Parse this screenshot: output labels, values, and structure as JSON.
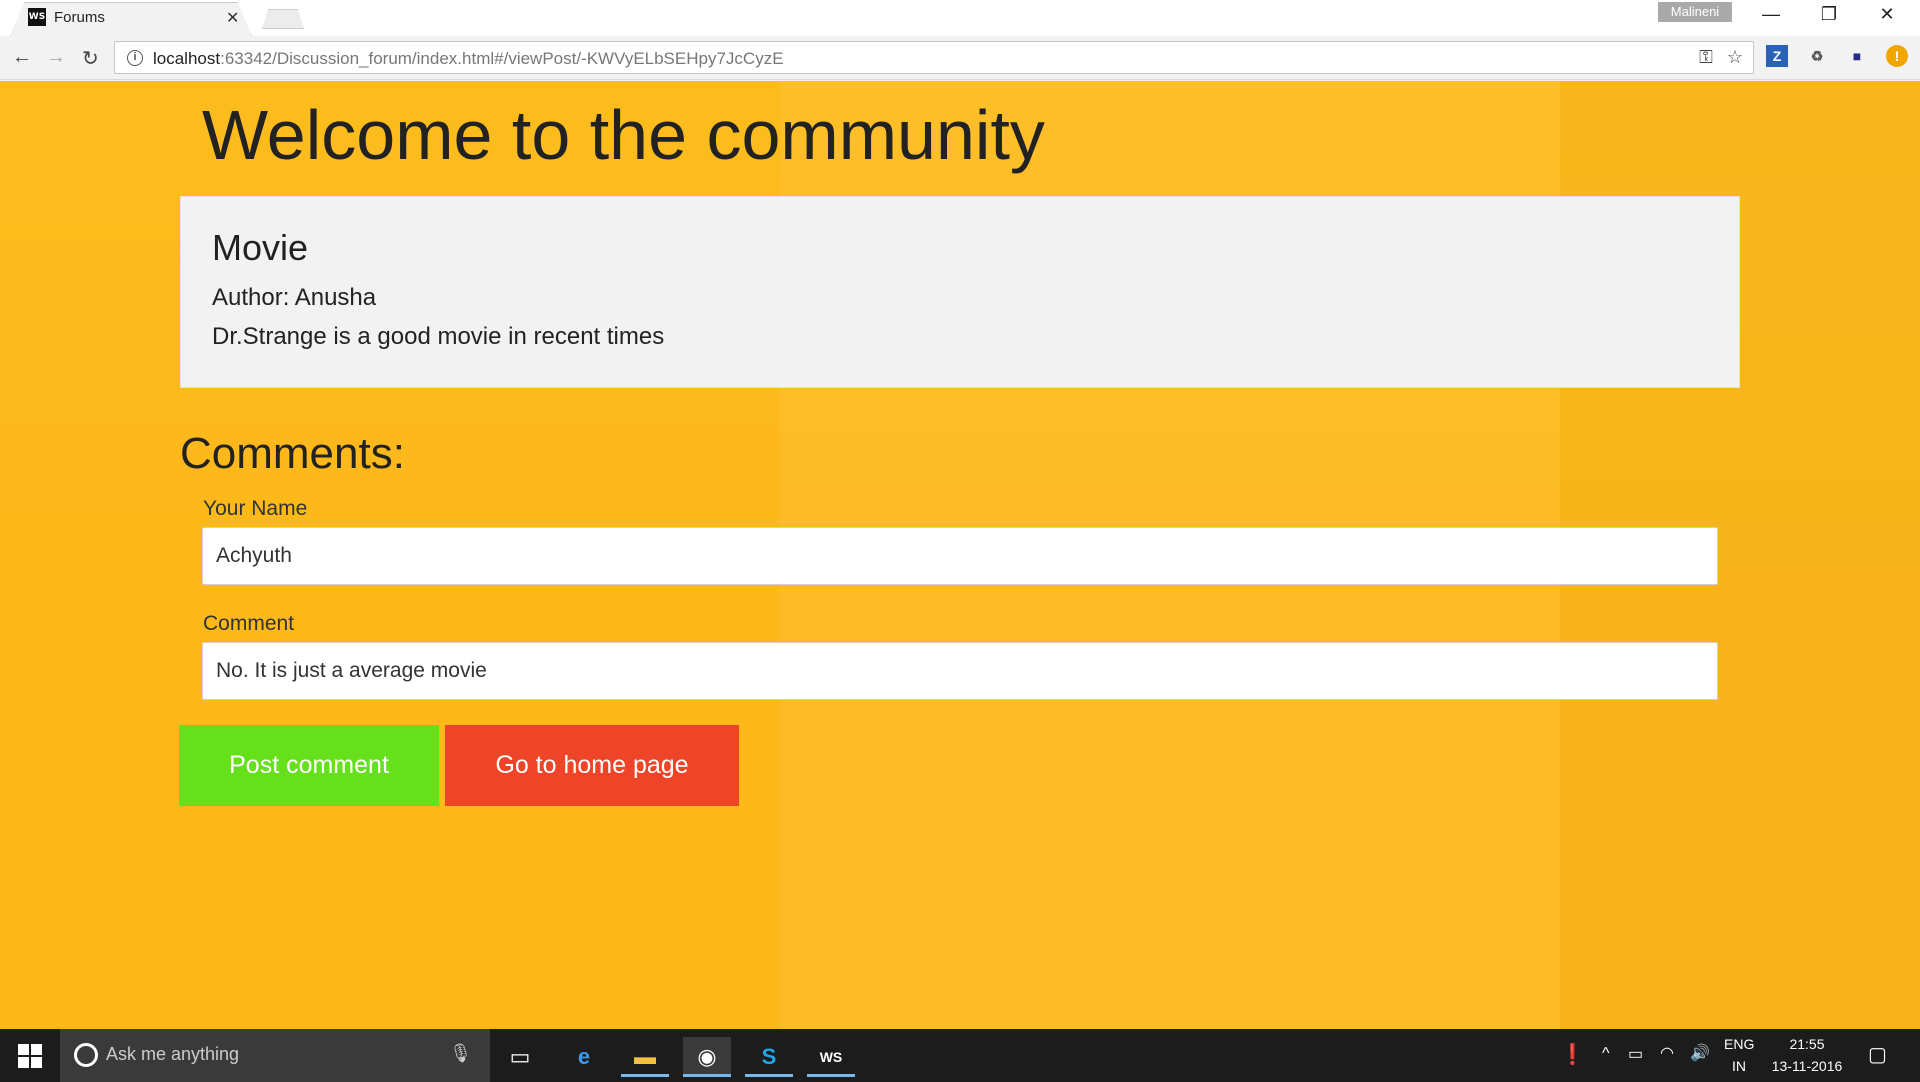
{
  "browser": {
    "tab_title": "Forums",
    "tab_favicon": "WS",
    "profile_name": "Malineni",
    "url_host": "localhost",
    "url_rest": ":63342/Discussion_forum/index.html#/viewPost/-KWVyELbSEHpy7JcCyzE"
  },
  "page": {
    "heading": "Welcome to the community",
    "post": {
      "title": "Movie",
      "author": "Author: Anusha",
      "body": "Dr.Strange is a good movie in recent times"
    },
    "comments_heading": "Comments:",
    "name_label": "Your Name",
    "name_value": "Achyuth",
    "comment_label": "Comment",
    "comment_value": "No. It is just a average movie",
    "post_button": "Post comment",
    "home_button": "Go to home page",
    "colors": {
      "background": "#fdb81a",
      "post_button": "#66e01a",
      "home_button": "#ee4427"
    }
  },
  "taskbar": {
    "search_placeholder": "Ask me anything",
    "lang_top": "ENG",
    "lang_bottom": "IN",
    "time": "21:55",
    "date": "13-11-2016"
  }
}
